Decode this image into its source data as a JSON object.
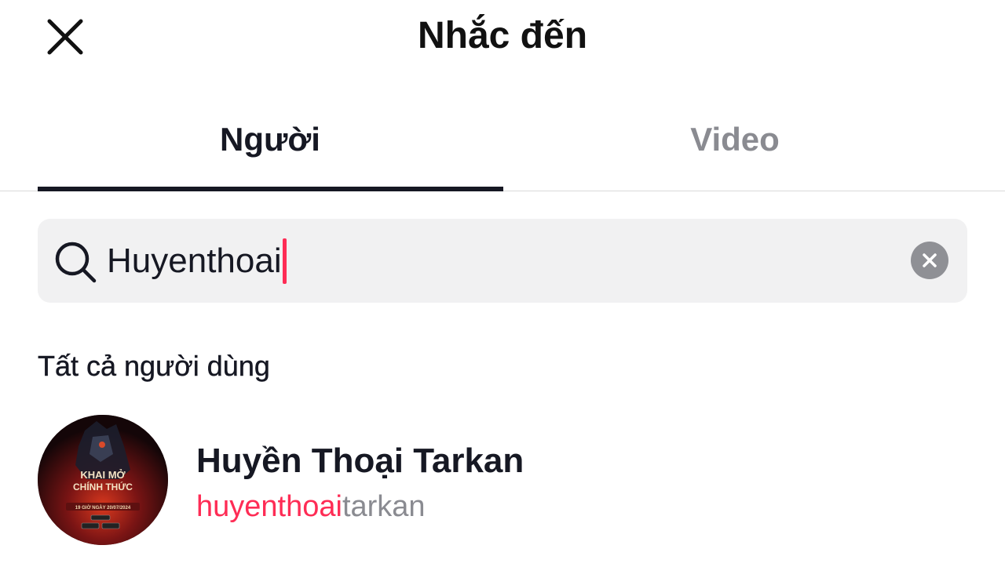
{
  "header": {
    "title": "Nhắc đến",
    "close_icon": "close-icon"
  },
  "tabs": [
    {
      "label": "Người",
      "active": true
    },
    {
      "label": "Video",
      "active": false
    }
  ],
  "search": {
    "value": "Huyenthoai",
    "search_icon": "search-icon",
    "clear_icon": "clear-icon"
  },
  "results": {
    "section_label": "Tất cả người dùng",
    "users": [
      {
        "display_name": "Huyền Thoại Tarkan",
        "handle_match": "huyenthoai",
        "handle_rest": "tarkan",
        "avatar_text_line1": "KHAI MỞ",
        "avatar_text_line2": "CHÍNH THỨC",
        "avatar_text_line3": "19 GIỜ NGÀY 20/07/2024"
      }
    ]
  },
  "colors": {
    "accent": "#fe2c55",
    "primary_text": "#161823",
    "secondary_text": "#8a8b91",
    "search_bg": "#f1f1f2"
  }
}
